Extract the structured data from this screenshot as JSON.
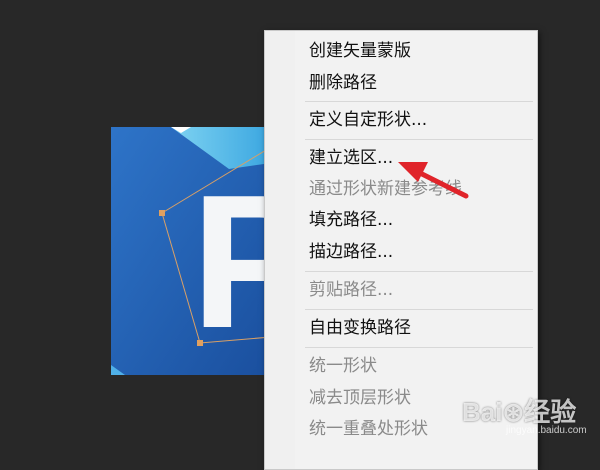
{
  "canvas": {
    "logo_letter": "P"
  },
  "context_menu": {
    "items": [
      {
        "label": "创建矢量蒙版",
        "enabled": true
      },
      {
        "label": "删除路径",
        "enabled": true
      },
      {
        "label": "定义自定形状...",
        "enabled": true
      },
      {
        "label": "建立选区...",
        "enabled": true
      },
      {
        "label": "通过形状新建参考线",
        "enabled": false
      },
      {
        "label": "填充路径...",
        "enabled": true
      },
      {
        "label": "描边路径...",
        "enabled": true
      },
      {
        "label": "剪贴路径...",
        "enabled": false
      },
      {
        "label": "自由变换路径",
        "enabled": true
      },
      {
        "label": "统一形状",
        "enabled": false
      },
      {
        "label": "减去顶层形状",
        "enabled": false
      },
      {
        "label": "统一重叠处形状",
        "enabled": false
      }
    ]
  },
  "annotation": {
    "color": "#e0242a"
  },
  "watermark": {
    "brand": "Bai⊛经验",
    "url": "jingyan.baidu.com"
  },
  "colors": {
    "background": "#282828",
    "menu_background": "#f2f2f2",
    "enabled_text": "#111111",
    "disabled_text": "#8a8a8a",
    "logo_blue": "#1f5fb3"
  }
}
